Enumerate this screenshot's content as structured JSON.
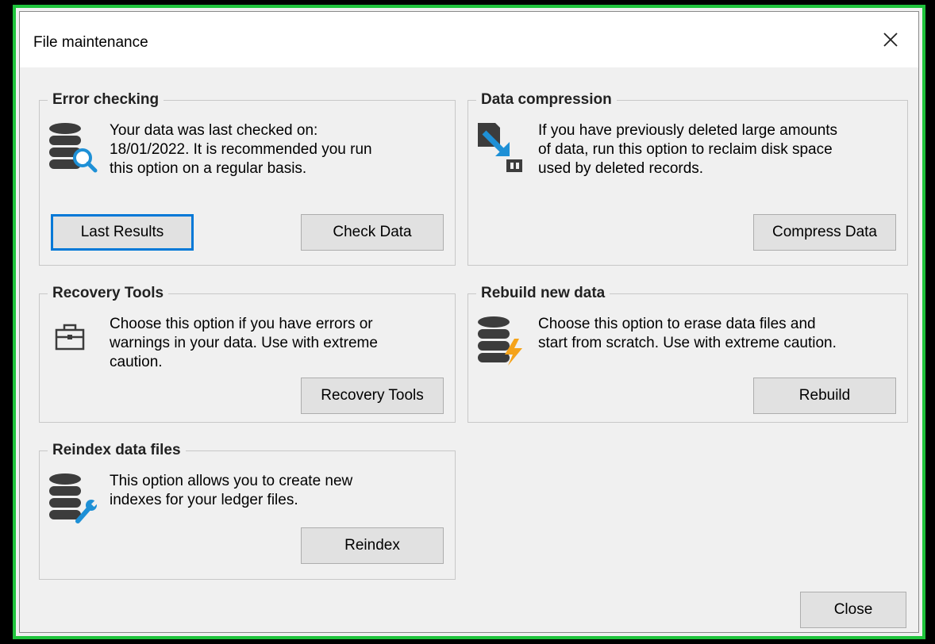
{
  "window": {
    "title": "File maintenance"
  },
  "groups": {
    "error_checking": {
      "title": "Error checking",
      "desc_lines": [
        "Your data was last checked on:",
        "18/01/2022.  It is recommended you run",
        "this option on a regular basis."
      ],
      "buttons": {
        "last_results": "Last Results",
        "check_data": "Check Data"
      }
    },
    "data_compression": {
      "title": "Data compression",
      "desc_lines": [
        "If you have previously deleted large amounts",
        "of data, run this option to reclaim disk space",
        "used by deleted records."
      ],
      "buttons": {
        "compress_data": "Compress Data"
      }
    },
    "recovery_tools": {
      "title": "Recovery Tools",
      "desc_lines": [
        "Choose this option if you have errors or",
        "warnings in your data. Use with extreme",
        "caution."
      ],
      "buttons": {
        "recovery_tools": "Recovery Tools"
      }
    },
    "rebuild": {
      "title": "Rebuild new data",
      "desc_lines": [
        "Choose this option to erase data files and",
        "start from scratch. Use with extreme caution."
      ],
      "buttons": {
        "rebuild": "Rebuild"
      }
    },
    "reindex": {
      "title": "Reindex data files",
      "desc_lines": [
        "This option allows you to create new",
        "indexes for your ledger files."
      ],
      "buttons": {
        "reindex": "Reindex"
      }
    }
  },
  "footer": {
    "close_label": "Close"
  },
  "icons": {
    "close": "close-icon",
    "error_checking": "database-search-icon",
    "data_compression": "compress-icon",
    "recovery_tools": "toolbox-icon",
    "rebuild": "database-lightning-icon",
    "reindex": "database-wrench-icon"
  },
  "colors": {
    "accent": "#0078d7",
    "frame": "#1fc43c",
    "icon_dark": "#3c3c3c",
    "icon_blue": "#1e90d6",
    "bolt": "#f5a31a"
  }
}
